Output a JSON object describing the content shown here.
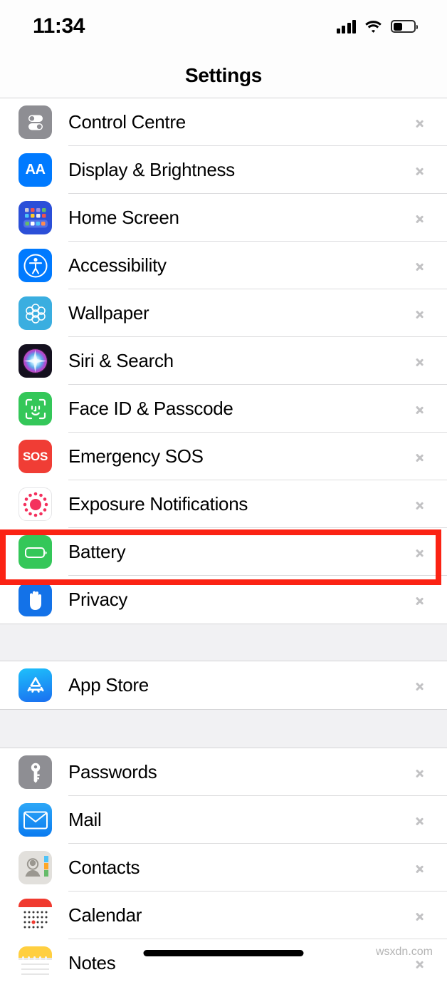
{
  "statusbar": {
    "time": "11:34",
    "signal_icon": "cellular-bars-icon",
    "wifi_icon": "wifi-icon",
    "battery_icon": "battery-icon",
    "battery_level_pct": 45
  },
  "navbar": {
    "title": "Settings"
  },
  "annotation": {
    "color": "#fb2314",
    "highlights": "Battery"
  },
  "watermark": "wsxdn.com",
  "groups": [
    {
      "name": "system-group",
      "rows": [
        {
          "label": "Control Centre",
          "icon": "control-centre-icon",
          "chevron": "chevron-right-icon"
        },
        {
          "label": "Display & Brightness",
          "icon": "display-brightness-icon",
          "chevron": "chevron-right-icon"
        },
        {
          "label": "Home Screen",
          "icon": "home-screen-icon",
          "chevron": "chevron-right-icon"
        },
        {
          "label": "Accessibility",
          "icon": "accessibility-icon",
          "chevron": "chevron-right-icon"
        },
        {
          "label": "Wallpaper",
          "icon": "wallpaper-icon",
          "chevron": "chevron-right-icon"
        },
        {
          "label": "Siri & Search",
          "icon": "siri-search-icon",
          "chevron": "chevron-right-icon"
        },
        {
          "label": "Face ID & Passcode",
          "icon": "face-id-icon",
          "chevron": "chevron-right-icon"
        },
        {
          "label": "Emergency SOS",
          "icon": "emergency-sos-icon",
          "chevron": "chevron-right-icon"
        },
        {
          "label": "Exposure Notifications",
          "icon": "exposure-notifications-icon",
          "chevron": "chevron-right-icon"
        },
        {
          "label": "Battery",
          "icon": "battery-settings-icon",
          "chevron": "chevron-right-icon"
        },
        {
          "label": "Privacy",
          "icon": "privacy-icon",
          "chevron": "chevron-right-icon"
        }
      ]
    },
    {
      "name": "store-group",
      "rows": [
        {
          "label": "App Store",
          "icon": "app-store-icon",
          "chevron": "chevron-right-icon"
        }
      ]
    },
    {
      "name": "apps-group",
      "rows": [
        {
          "label": "Passwords",
          "icon": "passwords-icon",
          "chevron": "chevron-right-icon"
        },
        {
          "label": "Mail",
          "icon": "mail-icon",
          "chevron": "chevron-right-icon"
        },
        {
          "label": "Contacts",
          "icon": "contacts-icon",
          "chevron": "chevron-right-icon"
        },
        {
          "label": "Calendar",
          "icon": "calendar-icon",
          "chevron": "chevron-right-icon"
        },
        {
          "label": "Notes",
          "icon": "notes-icon",
          "chevron": "chevron-right-icon"
        }
      ]
    }
  ],
  "icon_glyphs": {
    "display_brightness_text": "AA",
    "emergency_sos_text": "SOS"
  }
}
